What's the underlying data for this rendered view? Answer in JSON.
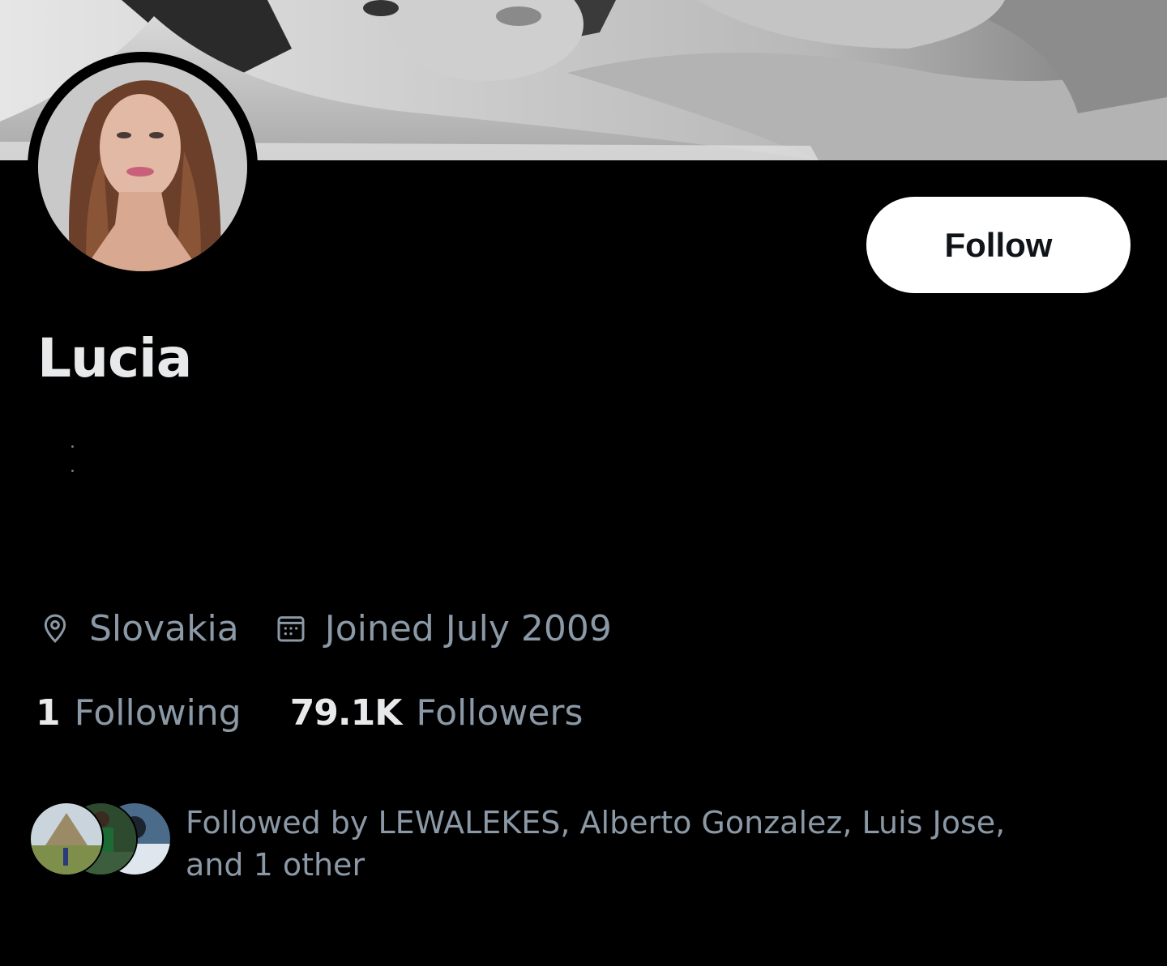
{
  "profile": {
    "display_name": "Lucia",
    "follow_label": "Follow",
    "location": "Slovakia",
    "joined": "Joined July 2009",
    "following_count": "1",
    "following_label": "Following",
    "followers_count": "79.1K",
    "followers_label": "Followers",
    "followed_by_text": "Followed by LEWALEKES, Alberto Gonzalez, Luis Jose, and 1 other"
  },
  "icons": {
    "location": "location-pin-icon",
    "calendar": "calendar-icon"
  },
  "colors": {
    "background": "#000000",
    "primary_text": "#e7e9ea",
    "secondary_text": "#8b98a5",
    "follow_button_bg": "#ffffff",
    "follow_button_text": "#0f1419"
  }
}
